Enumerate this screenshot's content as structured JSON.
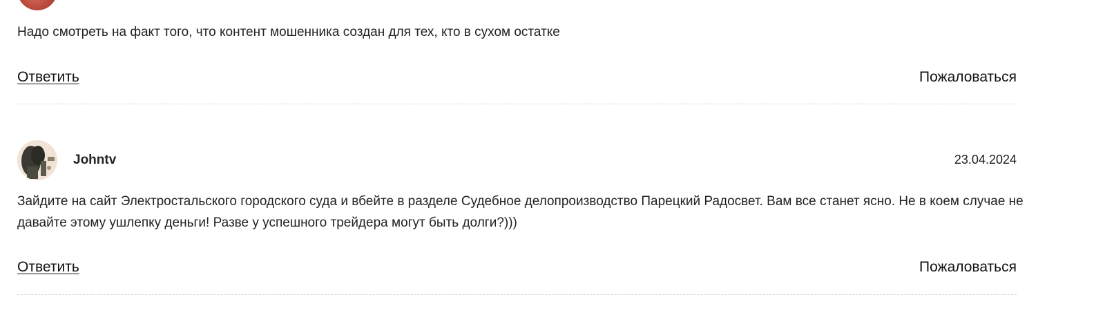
{
  "comments": [
    {
      "text": "Надо смотреть на факт того, что контент мошенника создан для тех, кто в сухом остатке",
      "reply_label": "Ответить",
      "report_label": "Пожаловаться"
    },
    {
      "author": "Johntv",
      "date": "23.04.2024",
      "text": "Зайдите на сайт Электростальского городского суда и вбейте в разделе Судебное делопроизводство Парецкий Радосвет. Вам все станет ясно. Не в коем случае не давайте этому ушлепку деньги! Разве у успешного трейдера могут быть долги?)))",
      "reply_label": "Ответить",
      "report_label": "Пожаловаться"
    }
  ]
}
